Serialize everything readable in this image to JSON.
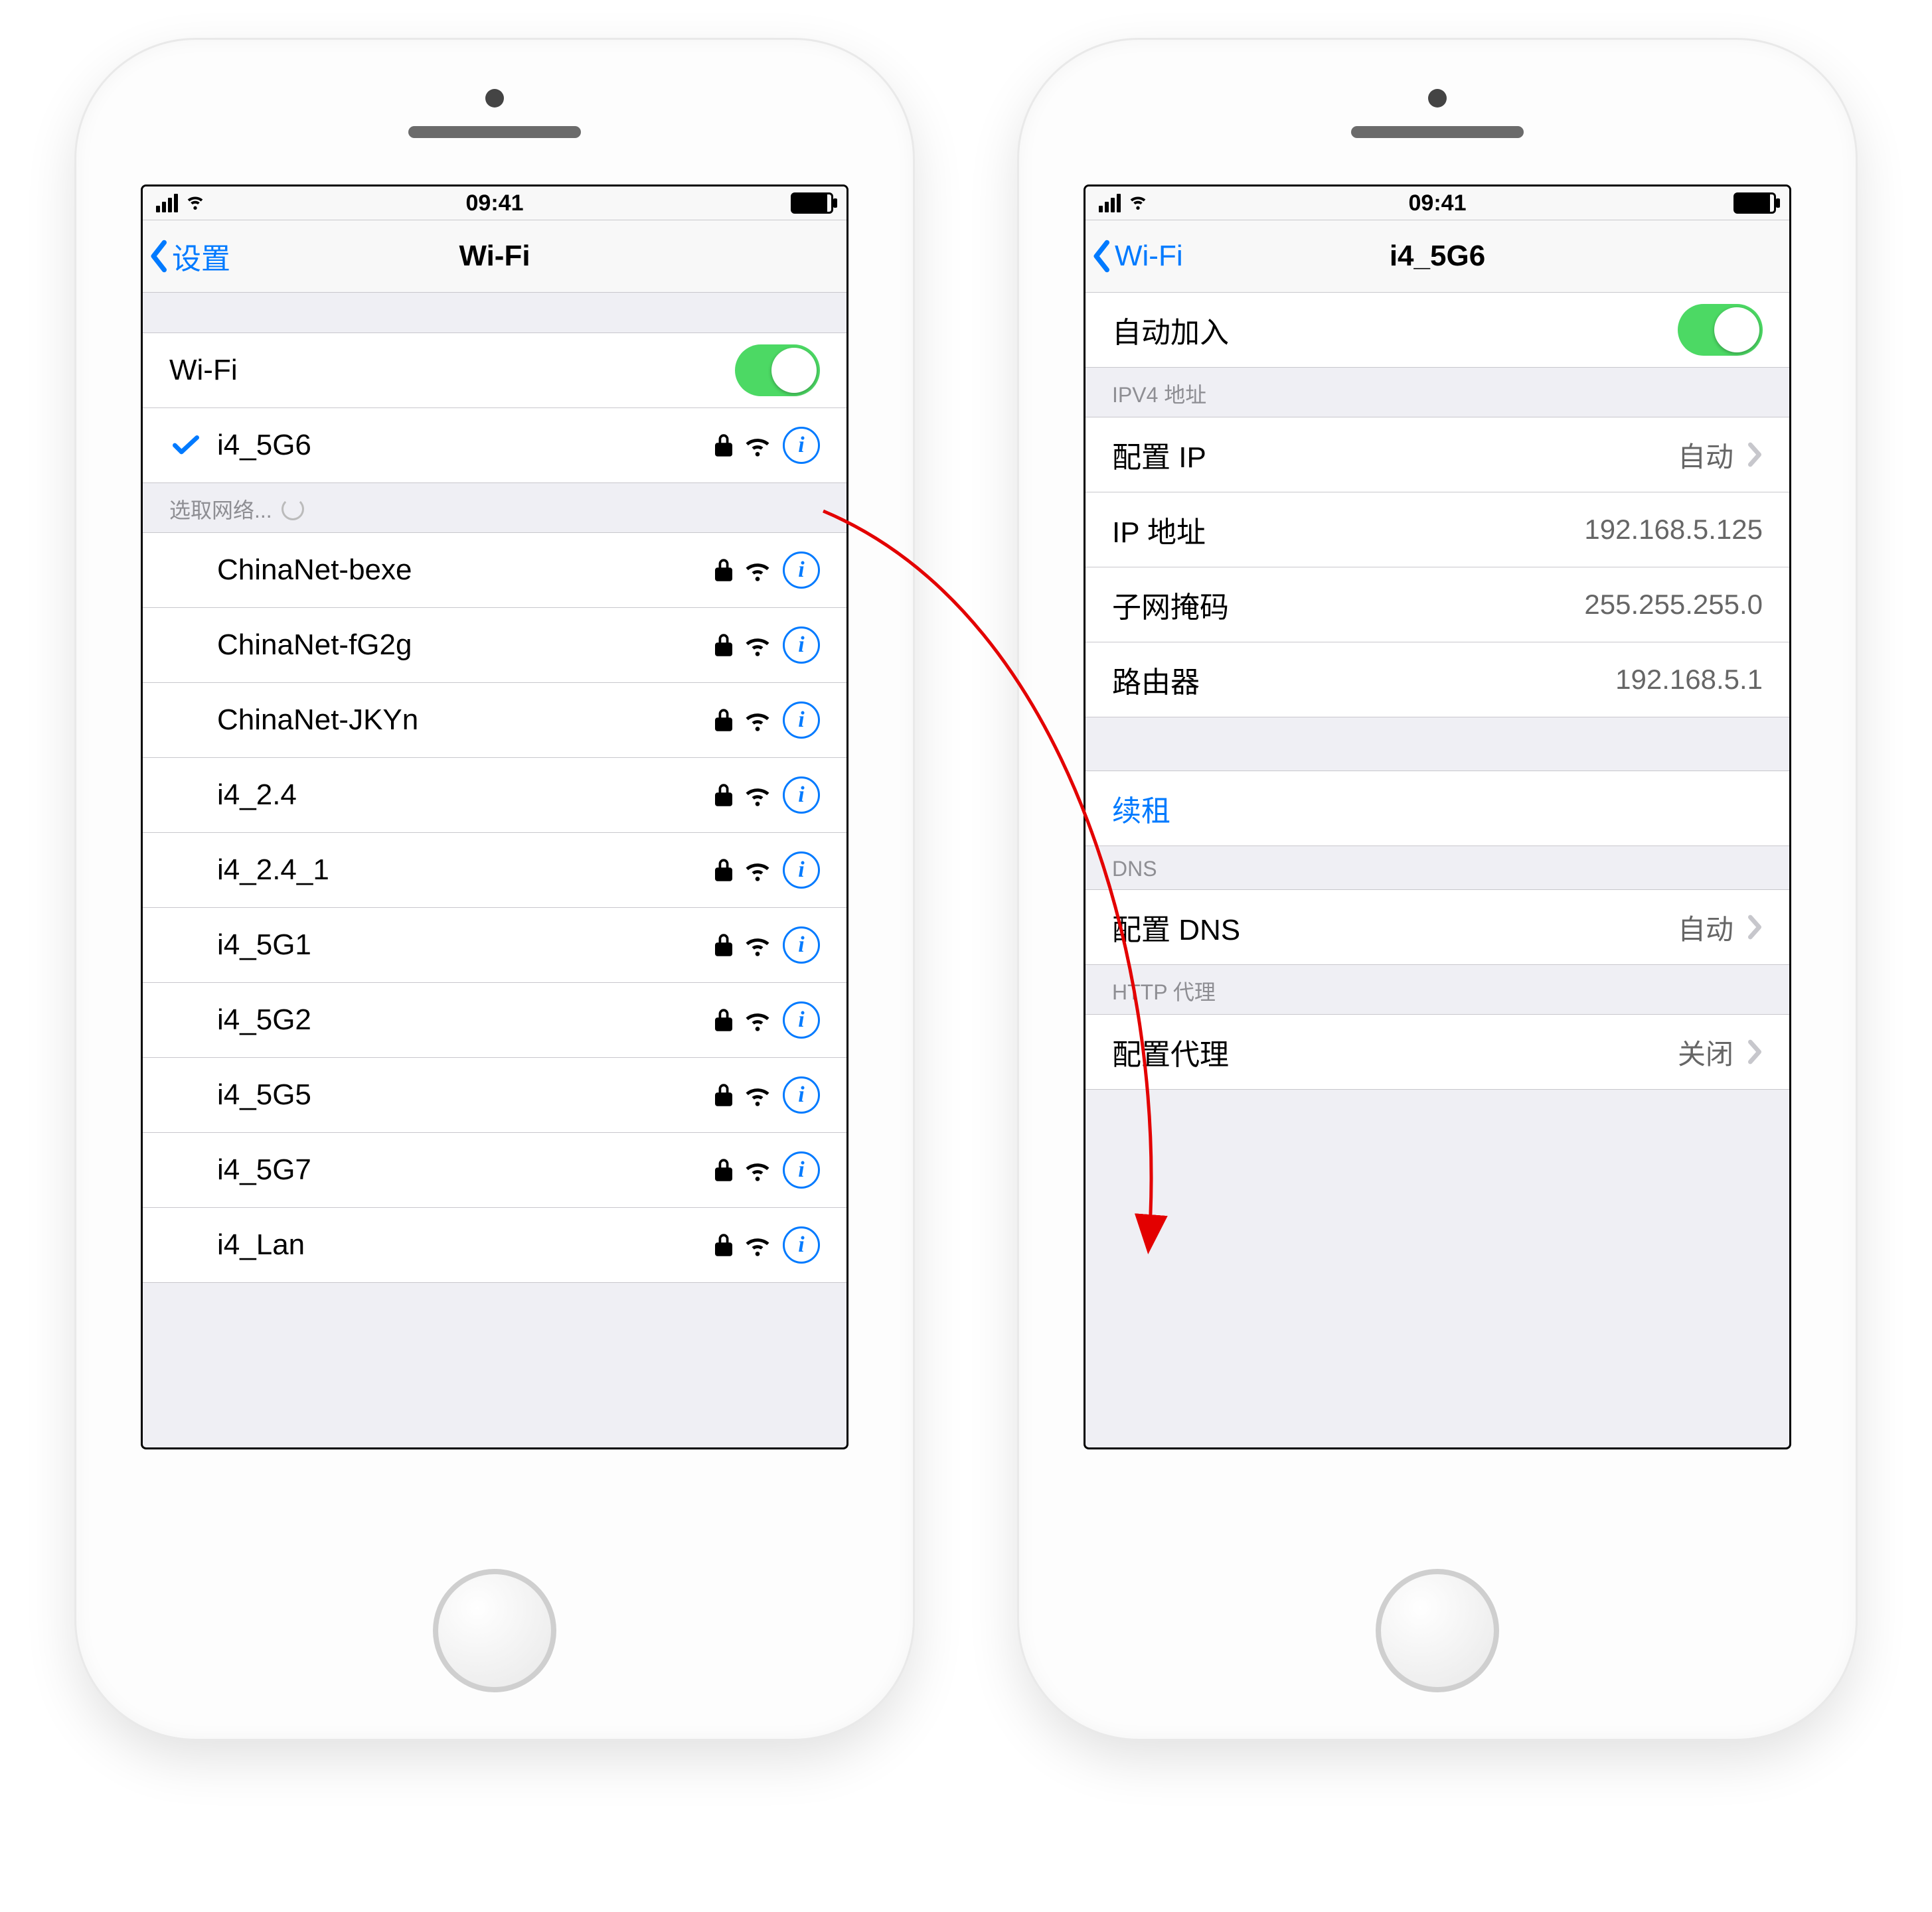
{
  "status": {
    "time": "09:41"
  },
  "phone1": {
    "nav": {
      "back": "设置",
      "title": "Wi-Fi"
    },
    "wifi_toggle_label": "Wi-Fi",
    "connected_network": "i4_5G6",
    "choose_header": "选取网络...",
    "networks": [
      "ChinaNet-bexe",
      "ChinaNet-fG2g",
      "ChinaNet-JKYn",
      "i4_2.4",
      "i4_2.4_1",
      "i4_5G1",
      "i4_5G2",
      "i4_5G5",
      "i4_5G7",
      "i4_Lan"
    ]
  },
  "phone2": {
    "nav": {
      "back": "Wi-Fi",
      "title": "i4_5G6"
    },
    "auto_join_label": "自动加入",
    "ipv4_header": "IPV4 地址",
    "rows": {
      "configure_ip_label": "配置 IP",
      "configure_ip_value": "自动",
      "ip_label": "IP 地址",
      "ip_value": "192.168.5.125",
      "subnet_label": "子网掩码",
      "subnet_value": "255.255.255.0",
      "router_label": "路由器",
      "router_value": "192.168.5.1"
    },
    "renew_label": "续租",
    "dns_header": "DNS",
    "configure_dns_label": "配置 DNS",
    "configure_dns_value": "自动",
    "proxy_header": "HTTP 代理",
    "configure_proxy_label": "配置代理",
    "configure_proxy_value": "关闭"
  }
}
